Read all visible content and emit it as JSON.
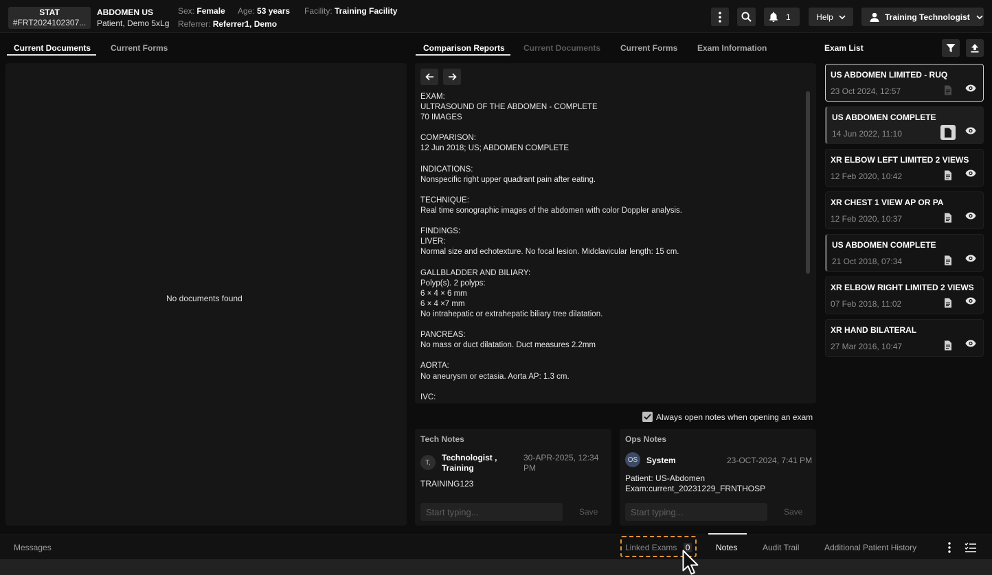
{
  "header": {
    "priority": "STAT",
    "accession": "#FRT2024102307...",
    "exam_title": "ABDOMEN US",
    "patient_name": "Patient, Demo 5xLg",
    "sex_label": "Sex:",
    "sex": "Female",
    "age_label": "Age:",
    "age": "53 years",
    "facility_label": "Facility:",
    "facility": "Training Facility",
    "referrer_label": "Referrer:",
    "referrer": "Referrer1, Demo",
    "notifications_count": "1",
    "help_label": "Help",
    "user_label": "Training Technologist"
  },
  "left_tabs": [
    "Current Documents",
    "Current Forms"
  ],
  "left_panel": {
    "empty_text": "No documents found"
  },
  "center_tabs": [
    "Comparison Reports",
    "Current Documents",
    "Current Forms",
    "Exam Information"
  ],
  "report_lines": [
    "EXAM:",
    "ULTRASOUND OF THE ABDOMEN - COMPLETE",
    "70 IMAGES",
    "",
    "COMPARISON:",
    "12 Jun 2018; US; ABDOMEN COMPLETE",
    "",
    "INDICATIONS:",
    "Nonspecific right upper quadrant pain after eating.",
    "",
    "TECHNIQUE:",
    "Real time sonographic images of the abdomen with color Doppler analysis.",
    "",
    "FINDINGS:",
    "LIVER:",
    "Normal size and echotexture. No focal lesion. Midclavicular length: 15 cm.",
    "",
    "GALLBLADDER AND BILIARY:",
    "Polyp(s). 2 polyps:",
    "6 × 4 × 6 mm",
    "6 × 4 ×7 mm",
    "No intrahepatic or extrahepatic biliary tree dilatation.",
    "",
    "PANCREAS:",
    "No mass or duct dilatation. Duct measures 2.2mm",
    "",
    "AORTA:",
    "No aneurysm or ectasia. Aorta AP: 1.3 cm.",
    "",
    "IVC:"
  ],
  "always_open_notes_label": "Always open notes when opening an exam",
  "tech_notes": {
    "title": "Tech Notes",
    "avatar": "T,",
    "author_line1": "Technologist ,",
    "author_line2": "Training",
    "time_line1": "30-APR-2025, 12:34",
    "time_line2": "PM",
    "body": "TRAINING123",
    "placeholder": "Start typing...",
    "save_label": "Save"
  },
  "ops_notes": {
    "title": "Ops Notes",
    "avatar": "OS",
    "author": "System",
    "time": "23-OCT-2024, 7:41 PM",
    "body_line1": "Patient: US-Abdomen",
    "body_line2": "Exam:current_20231229_FRNTHOSP",
    "placeholder": "Start typing...",
    "save_label": "Save"
  },
  "exam_list": {
    "title": "Exam List",
    "items": [
      {
        "title": "US ABDOMEN LIMITED - RUQ",
        "date": "23 Oct 2024, 12:57"
      },
      {
        "title": "US ABDOMEN COMPLETE",
        "date": "14 Jun 2022, 11:10"
      },
      {
        "title": "XR ELBOW LEFT LIMITED 2 VIEWS",
        "date": "12 Feb 2020, 10:42"
      },
      {
        "title": "XR CHEST 1 VIEW AP OR PA",
        "date": "12 Feb 2020, 10:37"
      },
      {
        "title": "US ABDOMEN COMPLETE",
        "date": "21 Oct 2018, 07:34"
      },
      {
        "title": "XR ELBOW RIGHT LIMITED 2 VIEWS",
        "date": "07 Feb 2018, 11:02"
      },
      {
        "title": "XR HAND BILATERAL",
        "date": "27 Mar 2016, 10:47"
      }
    ]
  },
  "bottom": {
    "messages": "Messages",
    "linked_exams": "Linked Exams",
    "linked_count": "0",
    "notes": "Notes",
    "audit_trail": "Audit Trail",
    "additional_history": "Additional Patient History"
  },
  "icons": [
    "kebab-icon",
    "search-icon",
    "bell-icon",
    "chevron-down-icon",
    "user-icon",
    "arrow-left-icon",
    "arrow-right-icon",
    "filter-icon",
    "upload-icon",
    "document-icon",
    "eye-icon",
    "checklist-icon",
    "cursor-icon"
  ],
  "colors": {
    "highlight_dashed": "#e0913a",
    "background": "#0d0d0d",
    "panel": "#161616"
  }
}
